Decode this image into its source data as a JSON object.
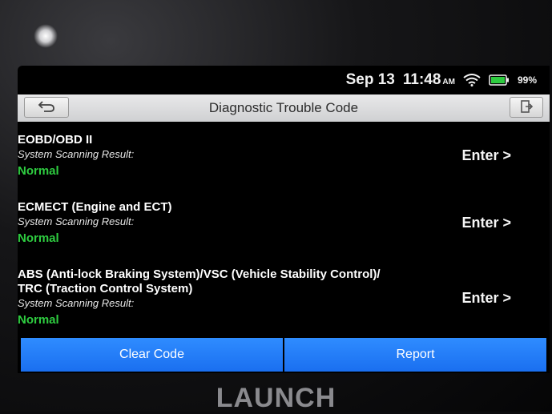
{
  "status_bar": {
    "date": "Sep 13",
    "time": "11:48",
    "ampm": "AM",
    "battery_pct": "99%",
    "icons": [
      "wifi-icon",
      "battery-icon"
    ]
  },
  "header": {
    "title": "Diagnostic Trouble Code",
    "back_icon": "back-arrow-icon",
    "exit_icon": "exit-icon"
  },
  "systems": [
    {
      "title_lines": [
        "EOBD/OBD II"
      ],
      "result_label": "System Scanning Result:",
      "result": "Normal",
      "enter_label": "Enter >"
    },
    {
      "title_lines": [
        "ECMECT (Engine and ECT)"
      ],
      "result_label": "System Scanning Result:",
      "result": "Normal",
      "enter_label": "Enter >"
    },
    {
      "title_lines": [
        "ABS (Anti-lock Braking System)/VSC (Vehicle Stability Control)/",
        "TRC (Traction Control System)"
      ],
      "result_label": "System Scanning Result:",
      "result": "Normal",
      "enter_label": "Enter >"
    }
  ],
  "footer": {
    "clear_code_label": "Clear Code",
    "report_label": "Report"
  },
  "brand": "LAUNCH",
  "colors": {
    "accent_blue": "#1a6ff0",
    "status_green": "#2ecc40"
  }
}
